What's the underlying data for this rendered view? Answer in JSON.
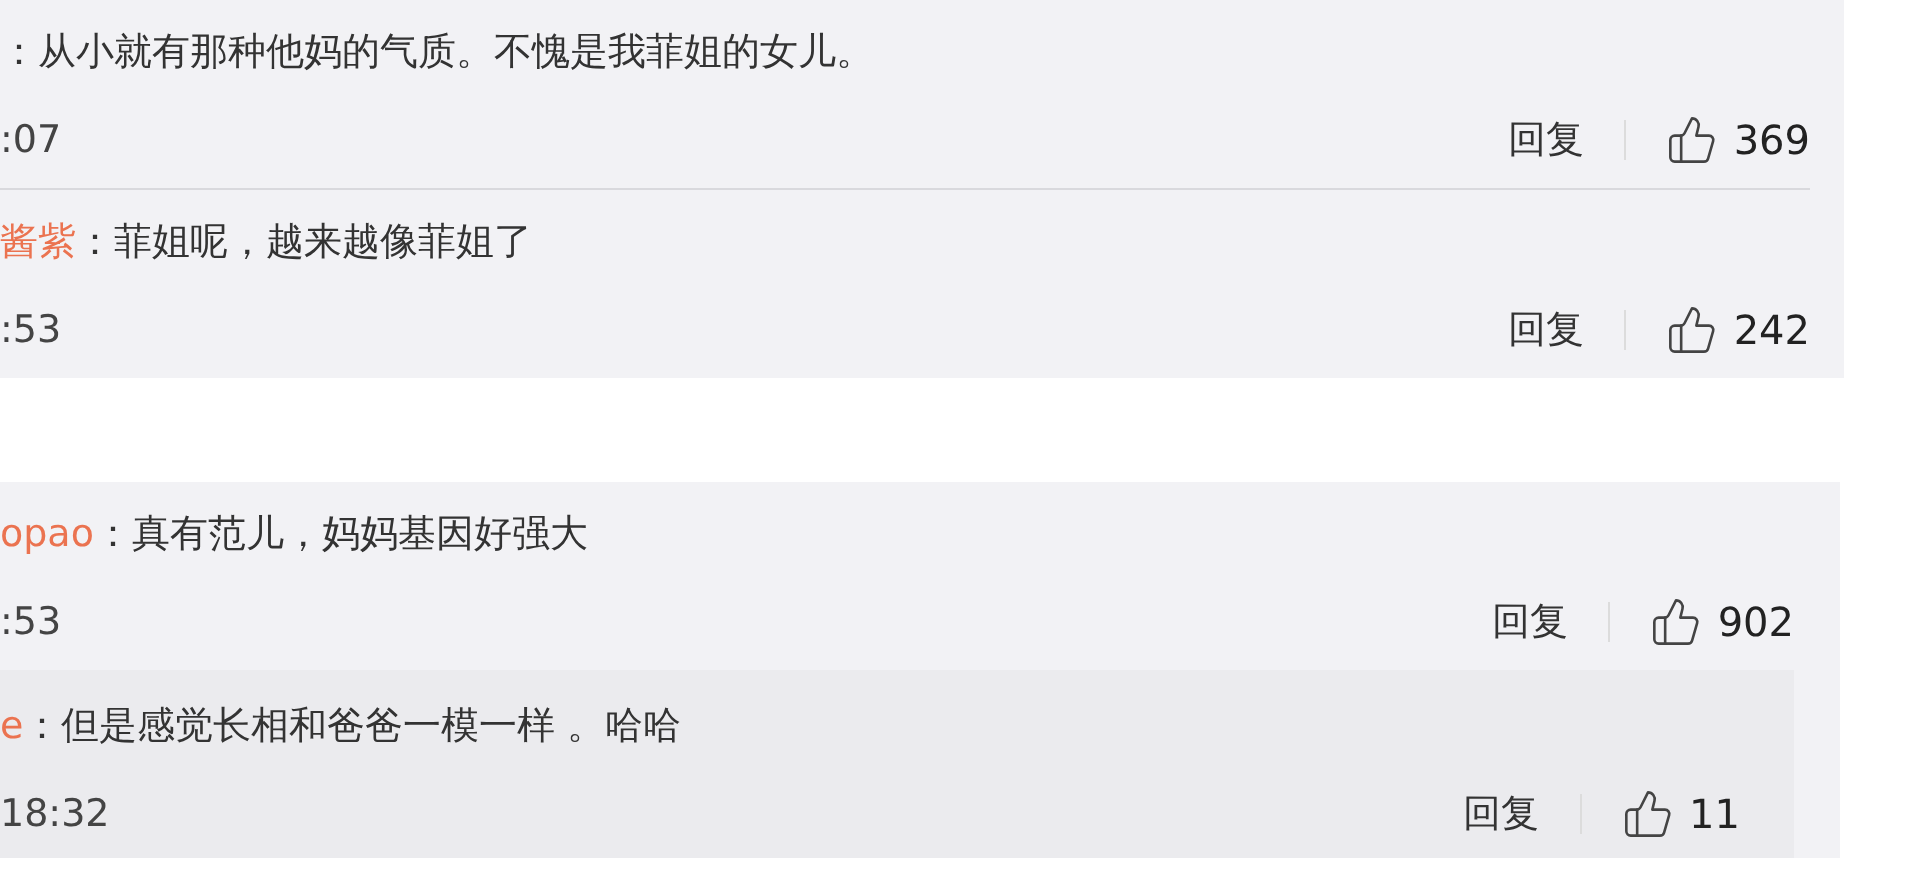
{
  "threads": [
    {
      "comments": [
        {
          "text": "：从小就有那种他妈的气质。不愧是我菲姐的女儿。",
          "time": ":07",
          "reply_label": "回复",
          "likes": "369"
        },
        {
          "username": "酱紫",
          "text": "：菲姐呢，越来越像菲姐了",
          "time": ":53",
          "reply_label": "回复",
          "likes": "242"
        }
      ]
    },
    {
      "comments": [
        {
          "username": "opao",
          "text": "：真有范儿，妈妈基因好强大",
          "time": ":53",
          "reply_label": "回复",
          "likes": "902",
          "replies": [
            {
              "username": "e",
              "text": "：但是感觉长相和爸爸一模一样 。哈哈",
              "time": "18:32",
              "reply_label": "回复",
              "likes": "11"
            }
          ]
        }
      ]
    }
  ]
}
